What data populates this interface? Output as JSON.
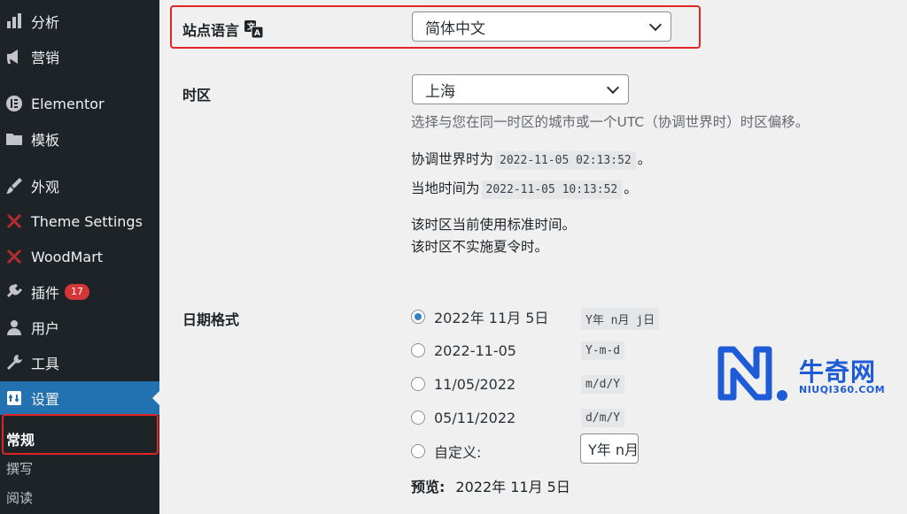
{
  "sidebar": {
    "items": [
      {
        "label": "分析",
        "icon": "bar-chart-icon"
      },
      {
        "label": "营销",
        "icon": "megaphone-icon"
      },
      {
        "label": "Elementor",
        "icon": "elementor-icon"
      },
      {
        "label": "模板",
        "icon": "folder-icon"
      },
      {
        "label": "外观",
        "icon": "brush-icon"
      },
      {
        "label": "Theme Settings",
        "icon": "woodmart-x-icon"
      },
      {
        "label": "WoodMart",
        "icon": "woodmart-x-icon"
      },
      {
        "label": "插件",
        "icon": "plugin-icon",
        "badge": "17"
      },
      {
        "label": "用户",
        "icon": "user-icon"
      },
      {
        "label": "工具",
        "icon": "wrench-icon"
      },
      {
        "label": "设置",
        "icon": "settings-icon"
      }
    ],
    "submenu": [
      {
        "label": "常规"
      },
      {
        "label": "撰写"
      },
      {
        "label": "阅读"
      }
    ]
  },
  "settings": {
    "site_language": {
      "label": "站点语言",
      "value": "简体中文",
      "icon": "translate-icon"
    },
    "timezone": {
      "label": "时区",
      "value": "上海",
      "description": "选择与您在同一时区的城市或一个UTC（协调世界时）时区偏移。",
      "utc_prefix": "协调世界时为",
      "utc_time": "2022-11-05 02:13:52",
      "utc_suffix": "。",
      "local_prefix": "当地时间为",
      "local_time": "2022-11-05 10:13:52",
      "local_suffix": "。",
      "note1": "该时区当前使用标准时间。",
      "note2": "该时区不实施夏令时。"
    },
    "date_format": {
      "label": "日期格式",
      "options": [
        {
          "label": "2022年 11月 5日",
          "format": "Y年 n月 j日",
          "checked": true
        },
        {
          "label": "2022-11-05",
          "format": "Y-m-d",
          "checked": false
        },
        {
          "label": "11/05/2022",
          "format": "m/d/Y",
          "checked": false
        },
        {
          "label": "05/11/2022",
          "format": "d/m/Y",
          "checked": false
        },
        {
          "label": "自定义:",
          "checked": false
        }
      ],
      "custom_value": "Y年 n月 j日",
      "preview_label": "预览:",
      "preview_value": "2022年 11月 5日"
    }
  },
  "watermark": {
    "title": "牛奇网",
    "subtitle": "NIUQI360.COM"
  },
  "colors": {
    "accent": "#2271b1",
    "highlight_box": "#e02424",
    "badge": "#d63638",
    "logo": "#1e5bd6"
  }
}
